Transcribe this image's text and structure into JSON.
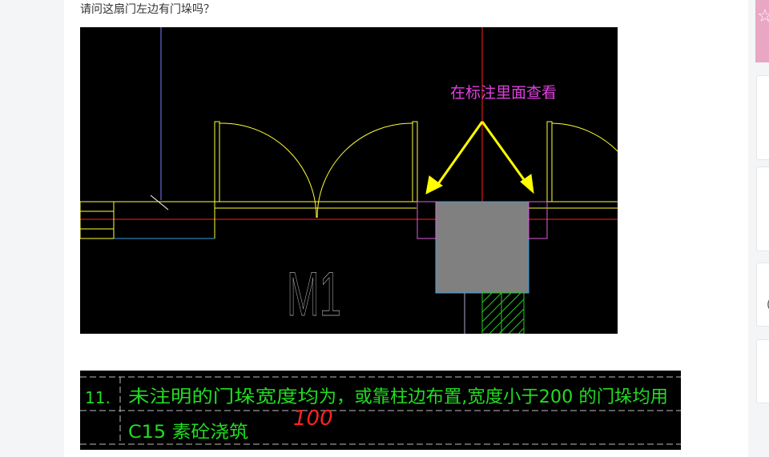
{
  "question": "请问这扇门左边有门垛吗？",
  "cad": {
    "annotation": "在标注里面查看",
    "door_label": "M1",
    "colors": {
      "background": "#000000",
      "wall_lines": "#ffff33",
      "axis_lines": "#ff2020",
      "column_fill": "#808080",
      "column_border": "#3fa0e0",
      "door_stub": "#e060e0",
      "hatch": "#22cc22",
      "annotation_text": "#e040e0",
      "arrows": "#ffff00"
    }
  },
  "note": {
    "row_number": "11.",
    "line1": "未注明的门垛宽度均",
    "line1_overwritten": "为",
    "line1_rest": "，或靠柱边布置,宽度小于200   的门垛均用",
    "line2": "C15   素砼浇筑",
    "handwritten": "100",
    "colors": {
      "text": "#22dd22",
      "handwritten": "#ff2222",
      "dashed_lines": "#bbbbbb"
    }
  },
  "sidebar": {
    "thumb_icon": "star-icon",
    "partial_char": "("
  }
}
